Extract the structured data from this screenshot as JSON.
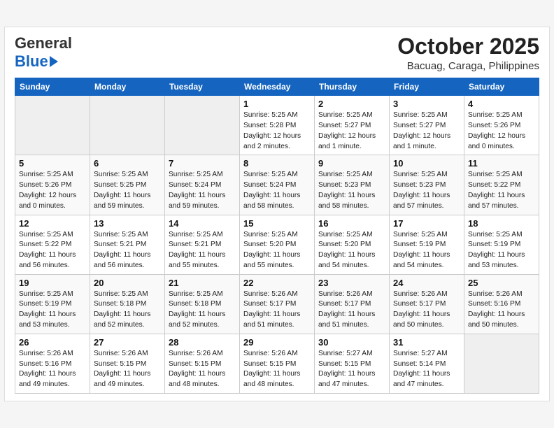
{
  "header": {
    "logo_general": "General",
    "logo_blue": "Blue",
    "month_title": "October 2025",
    "location": "Bacuag, Caraga, Philippines"
  },
  "days_of_week": [
    "Sunday",
    "Monday",
    "Tuesday",
    "Wednesday",
    "Thursday",
    "Friday",
    "Saturday"
  ],
  "weeks": [
    [
      {
        "day": "",
        "info": ""
      },
      {
        "day": "",
        "info": ""
      },
      {
        "day": "",
        "info": ""
      },
      {
        "day": "1",
        "sunrise": "Sunrise: 5:25 AM",
        "sunset": "Sunset: 5:28 PM",
        "daylight": "Daylight: 12 hours and 2 minutes."
      },
      {
        "day": "2",
        "sunrise": "Sunrise: 5:25 AM",
        "sunset": "Sunset: 5:27 PM",
        "daylight": "Daylight: 12 hours and 1 minute."
      },
      {
        "day": "3",
        "sunrise": "Sunrise: 5:25 AM",
        "sunset": "Sunset: 5:27 PM",
        "daylight": "Daylight: 12 hours and 1 minute."
      },
      {
        "day": "4",
        "sunrise": "Sunrise: 5:25 AM",
        "sunset": "Sunset: 5:26 PM",
        "daylight": "Daylight: 12 hours and 0 minutes."
      }
    ],
    [
      {
        "day": "5",
        "sunrise": "Sunrise: 5:25 AM",
        "sunset": "Sunset: 5:26 PM",
        "daylight": "Daylight: 12 hours and 0 minutes."
      },
      {
        "day": "6",
        "sunrise": "Sunrise: 5:25 AM",
        "sunset": "Sunset: 5:25 PM",
        "daylight": "Daylight: 11 hours and 59 minutes."
      },
      {
        "day": "7",
        "sunrise": "Sunrise: 5:25 AM",
        "sunset": "Sunset: 5:24 PM",
        "daylight": "Daylight: 11 hours and 59 minutes."
      },
      {
        "day": "8",
        "sunrise": "Sunrise: 5:25 AM",
        "sunset": "Sunset: 5:24 PM",
        "daylight": "Daylight: 11 hours and 58 minutes."
      },
      {
        "day": "9",
        "sunrise": "Sunrise: 5:25 AM",
        "sunset": "Sunset: 5:23 PM",
        "daylight": "Daylight: 11 hours and 58 minutes."
      },
      {
        "day": "10",
        "sunrise": "Sunrise: 5:25 AM",
        "sunset": "Sunset: 5:23 PM",
        "daylight": "Daylight: 11 hours and 57 minutes."
      },
      {
        "day": "11",
        "sunrise": "Sunrise: 5:25 AM",
        "sunset": "Sunset: 5:22 PM",
        "daylight": "Daylight: 11 hours and 57 minutes."
      }
    ],
    [
      {
        "day": "12",
        "sunrise": "Sunrise: 5:25 AM",
        "sunset": "Sunset: 5:22 PM",
        "daylight": "Daylight: 11 hours and 56 minutes."
      },
      {
        "day": "13",
        "sunrise": "Sunrise: 5:25 AM",
        "sunset": "Sunset: 5:21 PM",
        "daylight": "Daylight: 11 hours and 56 minutes."
      },
      {
        "day": "14",
        "sunrise": "Sunrise: 5:25 AM",
        "sunset": "Sunset: 5:21 PM",
        "daylight": "Daylight: 11 hours and 55 minutes."
      },
      {
        "day": "15",
        "sunrise": "Sunrise: 5:25 AM",
        "sunset": "Sunset: 5:20 PM",
        "daylight": "Daylight: 11 hours and 55 minutes."
      },
      {
        "day": "16",
        "sunrise": "Sunrise: 5:25 AM",
        "sunset": "Sunset: 5:20 PM",
        "daylight": "Daylight: 11 hours and 54 minutes."
      },
      {
        "day": "17",
        "sunrise": "Sunrise: 5:25 AM",
        "sunset": "Sunset: 5:19 PM",
        "daylight": "Daylight: 11 hours and 54 minutes."
      },
      {
        "day": "18",
        "sunrise": "Sunrise: 5:25 AM",
        "sunset": "Sunset: 5:19 PM",
        "daylight": "Daylight: 11 hours and 53 minutes."
      }
    ],
    [
      {
        "day": "19",
        "sunrise": "Sunrise: 5:25 AM",
        "sunset": "Sunset: 5:19 PM",
        "daylight": "Daylight: 11 hours and 53 minutes."
      },
      {
        "day": "20",
        "sunrise": "Sunrise: 5:25 AM",
        "sunset": "Sunset: 5:18 PM",
        "daylight": "Daylight: 11 hours and 52 minutes."
      },
      {
        "day": "21",
        "sunrise": "Sunrise: 5:25 AM",
        "sunset": "Sunset: 5:18 PM",
        "daylight": "Daylight: 11 hours and 52 minutes."
      },
      {
        "day": "22",
        "sunrise": "Sunrise: 5:26 AM",
        "sunset": "Sunset: 5:17 PM",
        "daylight": "Daylight: 11 hours and 51 minutes."
      },
      {
        "day": "23",
        "sunrise": "Sunrise: 5:26 AM",
        "sunset": "Sunset: 5:17 PM",
        "daylight": "Daylight: 11 hours and 51 minutes."
      },
      {
        "day": "24",
        "sunrise": "Sunrise: 5:26 AM",
        "sunset": "Sunset: 5:17 PM",
        "daylight": "Daylight: 11 hours and 50 minutes."
      },
      {
        "day": "25",
        "sunrise": "Sunrise: 5:26 AM",
        "sunset": "Sunset: 5:16 PM",
        "daylight": "Daylight: 11 hours and 50 minutes."
      }
    ],
    [
      {
        "day": "26",
        "sunrise": "Sunrise: 5:26 AM",
        "sunset": "Sunset: 5:16 PM",
        "daylight": "Daylight: 11 hours and 49 minutes."
      },
      {
        "day": "27",
        "sunrise": "Sunrise: 5:26 AM",
        "sunset": "Sunset: 5:15 PM",
        "daylight": "Daylight: 11 hours and 49 minutes."
      },
      {
        "day": "28",
        "sunrise": "Sunrise: 5:26 AM",
        "sunset": "Sunset: 5:15 PM",
        "daylight": "Daylight: 11 hours and 48 minutes."
      },
      {
        "day": "29",
        "sunrise": "Sunrise: 5:26 AM",
        "sunset": "Sunset: 5:15 PM",
        "daylight": "Daylight: 11 hours and 48 minutes."
      },
      {
        "day": "30",
        "sunrise": "Sunrise: 5:27 AM",
        "sunset": "Sunset: 5:15 PM",
        "daylight": "Daylight: 11 hours and 47 minutes."
      },
      {
        "day": "31",
        "sunrise": "Sunrise: 5:27 AM",
        "sunset": "Sunset: 5:14 PM",
        "daylight": "Daylight: 11 hours and 47 minutes."
      },
      {
        "day": "",
        "info": ""
      }
    ]
  ]
}
